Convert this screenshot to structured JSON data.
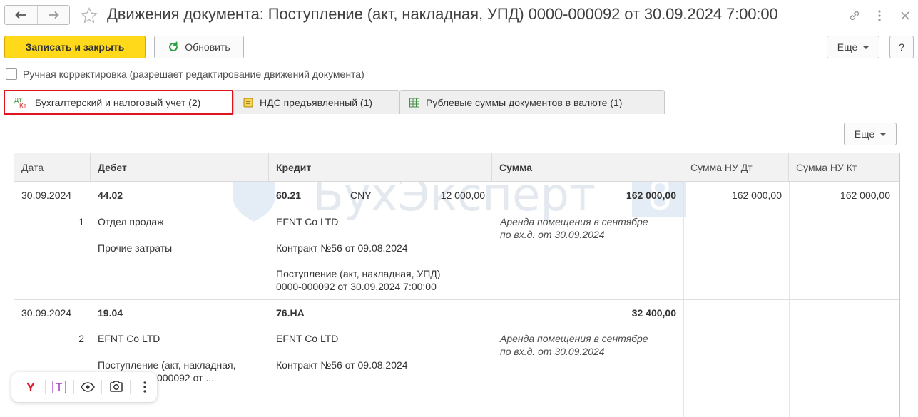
{
  "window": {
    "title": "Движения документа: Поступление (акт, накладная, УПД) 0000-000092 от 30.09.2024 7:00:00",
    "icons": [
      "arrow-left-icon",
      "arrow-right-icon",
      "star-icon",
      "link-icon",
      "more-vertical-icon",
      "close-icon"
    ]
  },
  "toolbar": {
    "save_close": "Записать и закрыть",
    "refresh": "Обновить",
    "more": "Еще",
    "help": "?"
  },
  "manual": {
    "label": "Ручная корректировка (разрешает редактирование движений документа)",
    "checked": false
  },
  "tabs": [
    {
      "label": "Бухгалтерский и налоговый учет (2)",
      "icon_text_top": "Дт",
      "icon_text_bottom": "Кт",
      "active": true
    },
    {
      "label": "НДС предъявленный (1)",
      "active": false
    },
    {
      "label": "Рублевые суммы документов в валюте (1)",
      "active": false
    }
  ],
  "grid": {
    "more": "Еще",
    "columns": [
      "Дата",
      "Дебет",
      "Кредит",
      "Сумма",
      "Сумма НУ Дт",
      "Сумма НУ Кт"
    ],
    "rows": [
      {
        "date": "30.09.2024",
        "num": "1",
        "debit_account": "44.02",
        "debit_sub1": "Отдел продаж",
        "debit_sub2": "Прочие затраты",
        "credit_account": "60.21",
        "currency": "CNY",
        "currency_amount": "12 000,00",
        "credit_sub1": "EFNT Co LTD",
        "credit_sub2": "Контракт №56 от 09.08.2024",
        "credit_sub3_line1": "Поступление (акт, накладная, УПД)",
        "credit_sub3_line2": "0000-000092 от 30.09.2024 7:00:00",
        "sum": "162 000,00",
        "content_line1": "Аренда помещения в сентябре",
        "content_line2": "по вх.д.  от 30.09.2024",
        "sum_nu_dt": "162 000,00",
        "sum_nu_kt": "162 000,00"
      },
      {
        "date": "30.09.2024",
        "num": "2",
        "debit_account": "19.04",
        "debit_sub1": "EFNT Co LTD",
        "debit_sub2_line1": "Поступление (акт, накладная,",
        "debit_sub2_line2": "000092 от ...",
        "credit_account": "76.НА",
        "credit_sub1": "EFNT Co LTD",
        "credit_sub2": "Контракт №56 от 09.08.2024",
        "sum": "32 400,00",
        "content_line1": "Аренда помещения в сентябре",
        "content_line2": "по вх.д.  от 30.09.2024"
      }
    ]
  },
  "watermark": {
    "text": "БухЭксперт",
    "badge": "8"
  },
  "floatbar": {
    "icons": [
      "yandex-icon",
      "translate-icon",
      "eye-icon",
      "screenshot-icon",
      "more-vertical-icon"
    ]
  },
  "colors": {
    "primary_button": "#ffd91a",
    "active_tab_border": "#e0141c",
    "refresh_icon": "#2ea043"
  }
}
